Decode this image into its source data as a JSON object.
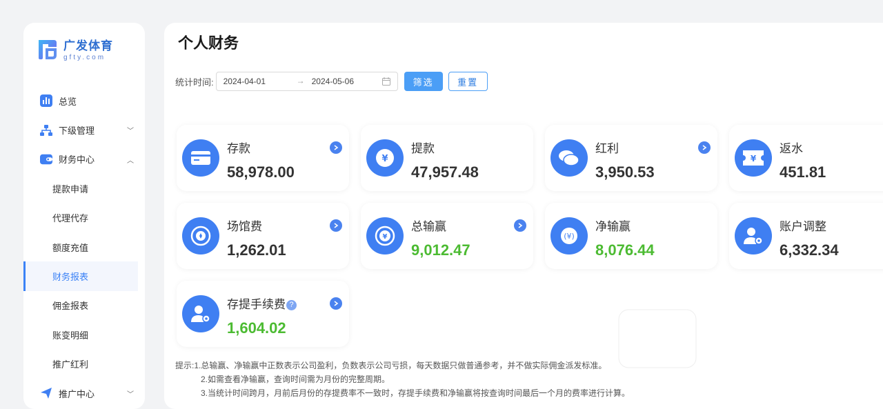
{
  "brand": {
    "name": "广发体育",
    "domain": "gfty.com"
  },
  "sidebar": {
    "items": [
      {
        "label": "总览",
        "icon": "bar-chart-icon"
      },
      {
        "label": "下级管理",
        "icon": "org-tree-icon",
        "chevron": "down"
      },
      {
        "label": "财务中心",
        "icon": "wallet-icon",
        "chevron": "up"
      },
      {
        "label": "提款申请"
      },
      {
        "label": "代理代存"
      },
      {
        "label": "额度充值"
      },
      {
        "label": "财务报表",
        "active": true
      },
      {
        "label": "佣金报表"
      },
      {
        "label": "账变明细"
      },
      {
        "label": "推广红利"
      },
      {
        "label": "推广中心",
        "icon": "send-icon",
        "chevron": "down"
      }
    ]
  },
  "page": {
    "title": "个人财务"
  },
  "filter": {
    "label": "统计时间:",
    "start_date": "2024-04-01",
    "separator": "→",
    "end_date": "2024-05-06",
    "filter_button": "筛选",
    "reset_button": "重置"
  },
  "cards": [
    {
      "label": "存款",
      "value": "58,978.00",
      "icon": "card-icon",
      "arrow": true,
      "green": false
    },
    {
      "label": "提款",
      "value": "47,957.48",
      "icon": "yen-circle-icon",
      "arrow": false,
      "green": false
    },
    {
      "label": "红利",
      "value": "3,950.53",
      "icon": "coins-icon",
      "arrow": true,
      "green": false
    },
    {
      "label": "返水",
      "value": "451.81",
      "icon": "yen-ticket-icon",
      "arrow": false,
      "green": false
    },
    {
      "label": "场馆费",
      "value": "1,262.01",
      "icon": "venue-icon",
      "arrow": true,
      "green": false
    },
    {
      "label": "总输赢",
      "value": "9,012.47",
      "icon": "yen-coin-icon",
      "arrow": true,
      "green": true
    },
    {
      "label": "净输赢",
      "value": "8,076.44",
      "icon": "yen-oval-icon",
      "arrow": false,
      "green": true
    },
    {
      "label": "账户调整",
      "value": "6,332.34",
      "icon": "user-gear-icon",
      "arrow": false,
      "green": false
    },
    {
      "label": "存提手续费",
      "value": "1,604.02",
      "icon": "user-gear-icon",
      "arrow": true,
      "green": true,
      "help": "?"
    }
  ],
  "tips": {
    "prefix": "提示:",
    "line1": "1.总输赢、净输赢中正数表示公司盈利，负数表示公司亏损，每天数据只做普通参考，并不做实际佣金派发标准。",
    "line2": "2.如需查看净输赢，查询时间需为月份的完整周期。",
    "line3": "3.当统计时间跨月，月前后月份的存提费率不一致时，存提手续费和净输赢将按查询时间最后一个月的费率进行计算。"
  },
  "colors": {
    "accent": "#3f7ff2",
    "positive": "#4cbb32",
    "active_nav": "#3b82f6"
  }
}
